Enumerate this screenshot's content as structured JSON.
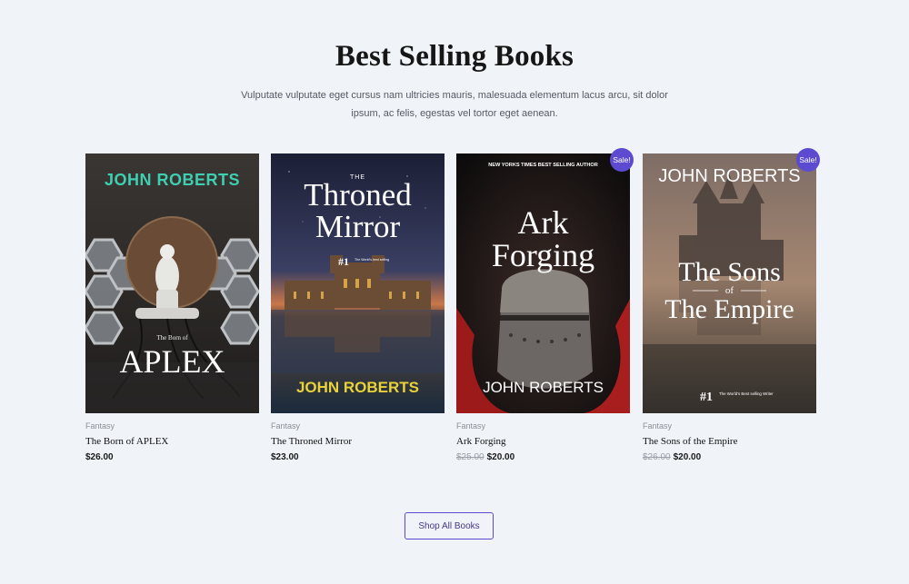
{
  "section": {
    "title": "Best Selling Books",
    "description": "Vulputate vulputate eget cursus nam ultricies mauris, malesuada elementum lacus arcu, sit dolor ipsum, ac felis, egestas vel tortor eget aenean."
  },
  "products": [
    {
      "category": "Fantasy",
      "title": "The Born of APLEX",
      "price": "$26.00",
      "old_price": null,
      "badge": null,
      "cover": {
        "author": "JOHN ROBERTS",
        "small": "The Born of",
        "big": "APLEX",
        "author_color": "#3ecfb0"
      }
    },
    {
      "category": "Fantasy",
      "title": "The Throned Mirror",
      "price": "$23.00",
      "old_price": null,
      "badge": null,
      "cover": {
        "top": "THE",
        "line1": "Throned",
        "line2": "Mirror",
        "rank": "#1",
        "rank_note": "The World's best selling",
        "author": "JOHN ROBERTS",
        "author_color": "#e8d23a"
      }
    },
    {
      "category": "Fantasy",
      "title": "Ark Forging",
      "price": "$20.00",
      "old_price": "$25.00",
      "badge": "Sale!",
      "cover": {
        "top": "NEW YORKS TIMES BEST SELLING AUTHOR",
        "line1": "Ark",
        "line2": "Forging",
        "author": "JOHN ROBERTS",
        "author_color": "#ffffff"
      }
    },
    {
      "category": "Fantasy",
      "title": "The Sons of the Empire",
      "price": "$20.00",
      "old_price": "$26.00",
      "badge": "Sale!",
      "cover": {
        "author": "JOHN ROBERTS",
        "line1": "The Sons",
        "of": "of",
        "line2": "The Empire",
        "rank": "#1",
        "rank_note": "The World's Best selling Writer",
        "author_color": "#ffffff"
      }
    }
  ],
  "cta": {
    "label": "Shop All Books"
  },
  "colors": {
    "accent": "#5b4bd1",
    "background": "#f0f3f8"
  }
}
